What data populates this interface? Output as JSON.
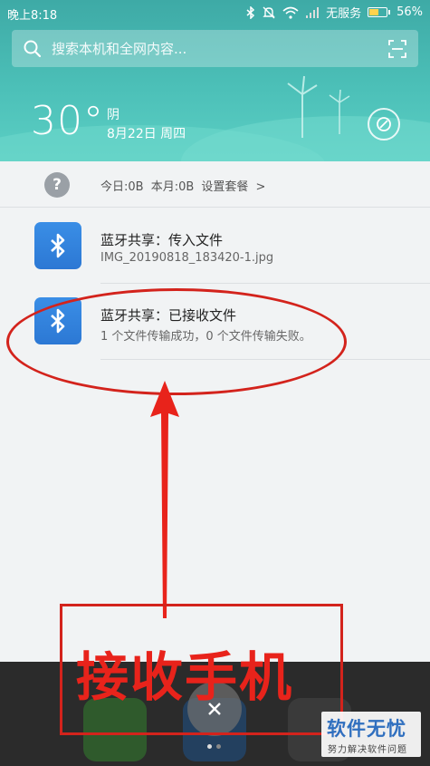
{
  "status_bar": {
    "time": "晚上8:18",
    "network": "无服务",
    "battery": "56%",
    "battery_level": 0.56,
    "icons": [
      "bluetooth-icon",
      "mute-icon",
      "wifi-icon",
      "signal-icon",
      "battery-icon"
    ]
  },
  "search": {
    "placeholder": "搜索本机和全网内容..."
  },
  "weather": {
    "temperature": "30°",
    "condition": "阴",
    "date": "8月22日 周四"
  },
  "data_usage": {
    "text": "今日:0B  本月:0B  设置套餐 >"
  },
  "notifications": [
    {
      "title": "蓝牙共享：传入文件",
      "subtitle": "IMG_20190818_183420-1.jpg",
      "icon": "bluetooth-icon"
    },
    {
      "title": "蓝牙共享：已接收文件",
      "subtitle": "1 个文件传输成功，0 个文件传输失败。",
      "icon": "bluetooth-icon"
    }
  ],
  "annotation": {
    "label": "接收手机",
    "color": "#d3231c"
  },
  "watermark": {
    "title": "软件无忧",
    "subtitle": "努力解决软件问题"
  },
  "colors": {
    "header_teal": "#4cc0b8",
    "bluetooth_blue": "#2c78d4",
    "panel_bg": "#f1f3f4"
  }
}
